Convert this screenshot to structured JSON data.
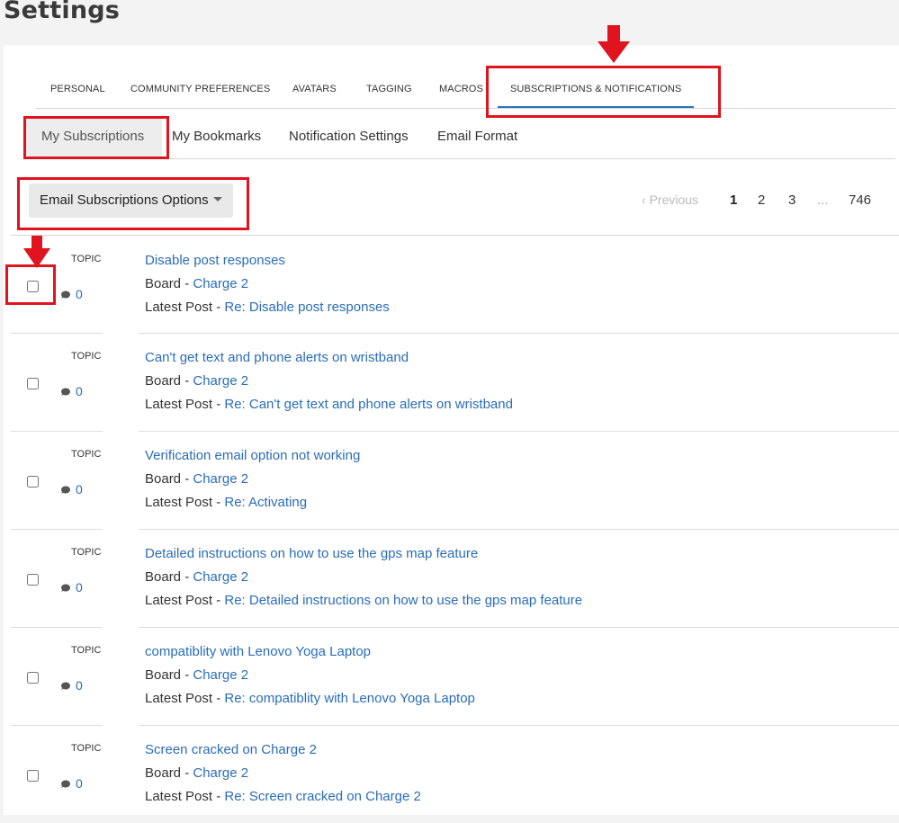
{
  "page": {
    "title": "Settings"
  },
  "tabs": [
    {
      "label": "PERSONAL"
    },
    {
      "label": "COMMUNITY PREFERENCES"
    },
    {
      "label": "AVATARS"
    },
    {
      "label": "TAGGING"
    },
    {
      "label": "MACROS"
    },
    {
      "label": "SUBSCRIPTIONS & NOTIFICATIONS",
      "active": true
    }
  ],
  "subtabs": [
    {
      "label": "My Subscriptions",
      "active": true
    },
    {
      "label": "My Bookmarks"
    },
    {
      "label": "Notification Settings"
    },
    {
      "label": "Email Format"
    }
  ],
  "options": {
    "label": "Email Subscriptions Options"
  },
  "pager": {
    "previous": "Previous",
    "pages": [
      "1",
      "2",
      "3"
    ],
    "ellipsis": "...",
    "last": "746",
    "current": "1"
  },
  "rows": [
    {
      "type": "TOPIC",
      "replies": "0",
      "title": "Disable post responses",
      "board_prefix": "Board - ",
      "board": "Charge 2",
      "latest_prefix": "Latest Post - ",
      "latest": "Re: Disable post responses"
    },
    {
      "type": "TOPIC",
      "replies": "0",
      "title": "Can't get text and phone alerts on wristband",
      "board_prefix": "Board - ",
      "board": "Charge 2",
      "latest_prefix": "Latest Post - ",
      "latest": "Re: Can't get text and phone alerts on wristband"
    },
    {
      "type": "TOPIC",
      "replies": "0",
      "title": "Verification email option not working",
      "board_prefix": "Board - ",
      "board": "Charge 2",
      "latest_prefix": "Latest Post - ",
      "latest": "Re: Activating"
    },
    {
      "type": "TOPIC",
      "replies": "0",
      "title": "Detailed instructions on how to use the gps map feature",
      "board_prefix": "Board - ",
      "board": "Charge 2",
      "latest_prefix": "Latest Post - ",
      "latest": "Re: Detailed instructions on how to use the gps map feature"
    },
    {
      "type": "TOPIC",
      "replies": "0",
      "title": "compatiblity with Lenovo Yoga Laptop",
      "board_prefix": "Board - ",
      "board": "Charge 2",
      "latest_prefix": "Latest Post - ",
      "latest": "Re: compatiblity with Lenovo Yoga Laptop"
    },
    {
      "type": "TOPIC",
      "replies": "0",
      "title": "Screen cracked on Charge 2",
      "board_prefix": "Board - ",
      "board": "Charge 2",
      "latest_prefix": "Latest Post - ",
      "latest": "Re: Screen cracked on Charge 2"
    }
  ],
  "icons": {
    "replies": "speech-bubble-icon",
    "previous": "chevron-left-icon",
    "options": "caret-down-icon",
    "annotation": "down-arrow-icon"
  },
  "colors": {
    "link": "#2a6db8",
    "active_tab_underline": "#2a74c4",
    "annotation": "#e0141e"
  }
}
